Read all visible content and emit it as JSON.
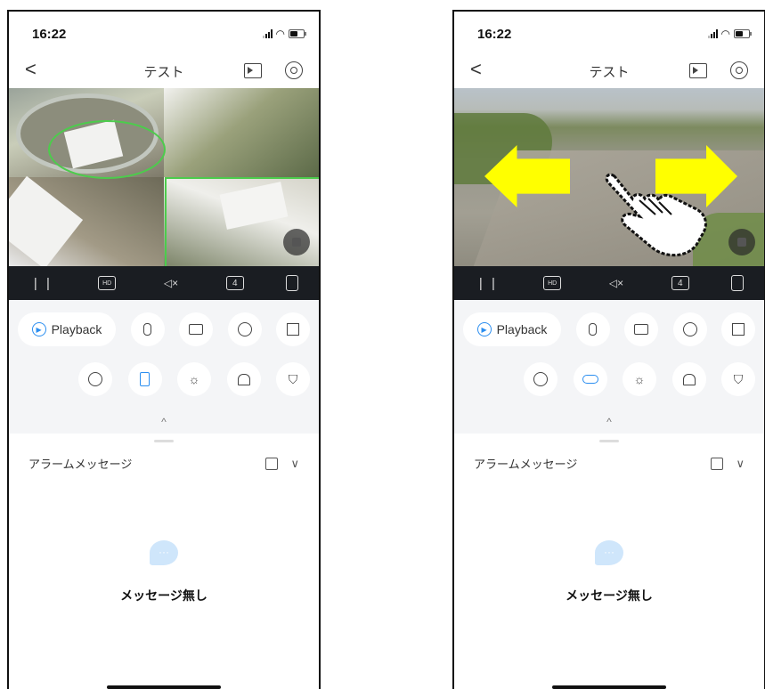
{
  "screens": [
    {
      "status": {
        "time": "16:22"
      },
      "nav": {
        "back": "<",
        "title": "テスト"
      },
      "video_mode": "quad-view",
      "controls": {
        "pause": "| |",
        "hd": "HD",
        "mute": "◁×",
        "split": "4"
      },
      "actions": {
        "playback_label": "Playback",
        "active_toggle": "phone-icon"
      },
      "chevron": "^",
      "alarm": {
        "title": "アラームメッセージ",
        "bubble": "···",
        "empty_text": "メッセージ無し"
      }
    },
    {
      "status": {
        "time": "16:22"
      },
      "nav": {
        "back": "<",
        "title": "テスト"
      },
      "video_mode": "single-view",
      "controls": {
        "pause": "| |",
        "hd": "HD",
        "mute": "◁×",
        "split": "4"
      },
      "actions": {
        "playback_label": "Playback",
        "active_toggle": "capsule-icon"
      },
      "chevron": "^",
      "alarm": {
        "title": "アラームメッセージ",
        "bubble": "···",
        "empty_text": "メッセージ無し"
      }
    }
  ],
  "colors": {
    "accent": "#2b8ef0",
    "detection_box": "#4ccc4c",
    "swipe_arrow": "#ffff00",
    "control_bar": "#1a1d22"
  }
}
